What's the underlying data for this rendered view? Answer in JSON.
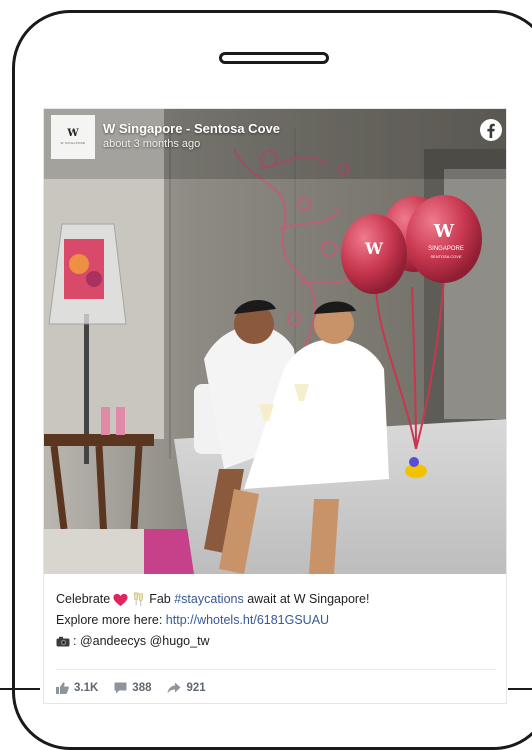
{
  "post": {
    "page_name": "W Singapore - Sentosa Cove",
    "time": "about 3 months ago",
    "avatar": {
      "letter": "W",
      "subtitle": "W SINGAPORE"
    },
    "balloon_text": {
      "logo": "W",
      "text": "SINGAPORE",
      "subtext": "SENTOSA COVE"
    },
    "caption": {
      "line1_pre": "Celebrate",
      "line1_mid": "Fab",
      "hashtag": "#staycations",
      "line1_post": "await at W Singapore!",
      "line2_pre": "Explore more here:",
      "link": "http://whotels.ht/6181GSUAU",
      "line3": ": @andeecys @hugo_tw"
    },
    "stats": {
      "likes": "3.1K",
      "comments": "388",
      "shares": "921"
    }
  },
  "colors": {
    "link": "#365899",
    "balloon": "#c8374f",
    "heart": "#e0245e",
    "facebook_icon": "#ffffff"
  },
  "icons": [
    "facebook-icon",
    "heart-emoji",
    "champagne-emoji",
    "camera-emoji",
    "like-icon",
    "comment-icon",
    "share-icon"
  ]
}
